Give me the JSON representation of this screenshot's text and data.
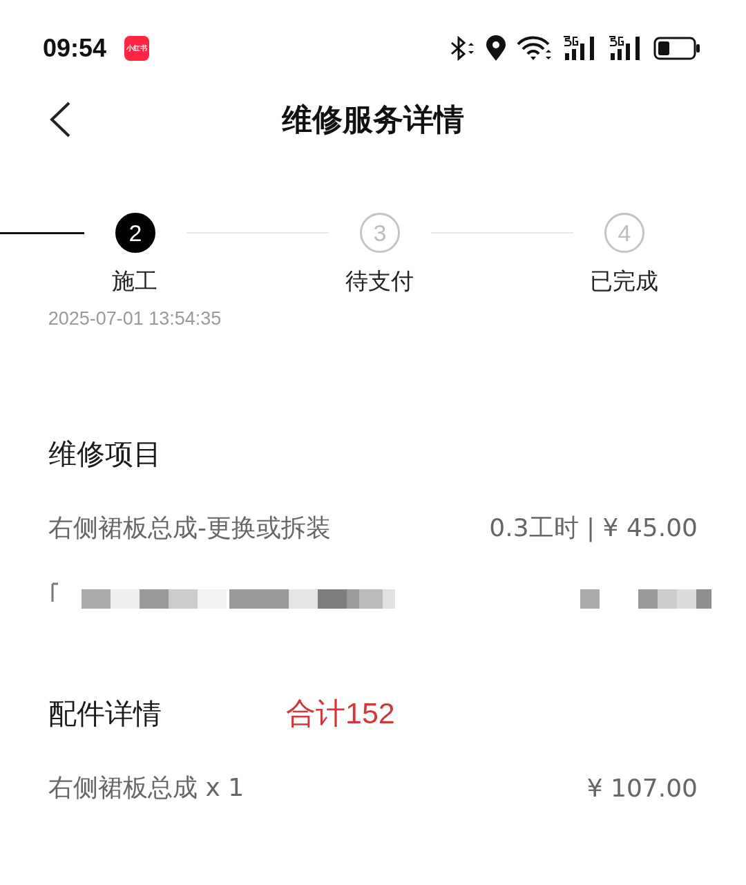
{
  "status_bar": {
    "time": "09:54",
    "app_badge": "小红书"
  },
  "nav": {
    "title": "维修服务详情"
  },
  "stepper": {
    "leading_line_done": true,
    "steps": [
      {
        "number": "2",
        "label": "施工",
        "time": "2025-07-01 13:54:35",
        "selected": true
      },
      {
        "number": "3",
        "label": "待支付",
        "selected": false
      },
      {
        "number": "4",
        "label": "已完成",
        "selected": false
      }
    ]
  },
  "repair_items": {
    "title": "维修项目",
    "items": [
      {
        "kind": "line",
        "name": "右侧裙板总成-更换或拆装",
        "detail": "0.3工时 | ¥ 45.00"
      },
      {
        "kind": "redacted"
      }
    ]
  },
  "parts": {
    "title": "配件详情",
    "total": "合计152",
    "items": [
      {
        "kind": "line",
        "name": "右侧裙板总成 x 1",
        "detail": "¥ 107.00"
      }
    ]
  }
}
